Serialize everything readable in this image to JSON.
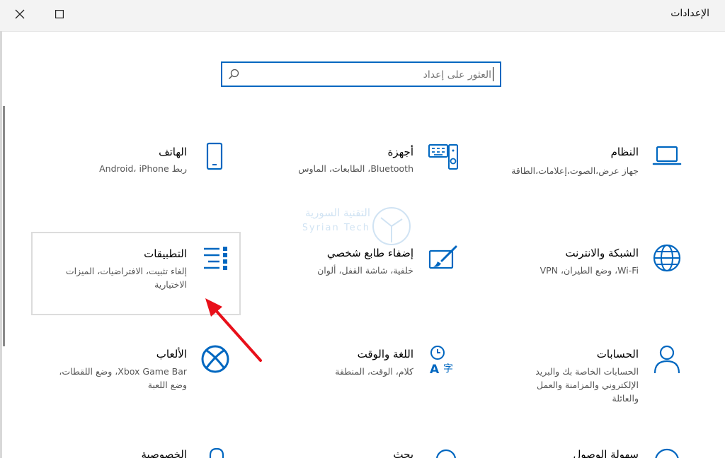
{
  "window": {
    "title": "الإعدادات",
    "close_icon": "close-icon",
    "maximize_icon": "maximize-icon"
  },
  "search": {
    "placeholder": "العثور على إعداد",
    "icon": "search-icon"
  },
  "tiles": {
    "system": {
      "title": "النظام",
      "desc": "جهاز عرض،الصوت،إعلامات،الطاقة",
      "icon": "laptop-icon"
    },
    "devices": {
      "title": "أجهزة",
      "desc": "Bluetooth، الطابعات، الماوس",
      "icon": "keyboard-speaker-icon"
    },
    "phone": {
      "title": "الهاتف",
      "desc": "ربط Android، iPhone",
      "icon": "phone-icon"
    },
    "network": {
      "title": "الشبكة والانترنت",
      "desc": "Wi-Fi، وضع الطيران، VPN",
      "icon": "globe-icon"
    },
    "personalization": {
      "title": "إضفاء طابع شخصي",
      "desc": "خلفية، شاشة القفل، ألوان",
      "icon": "paintbrush-icon"
    },
    "apps": {
      "title": "التطبيقات",
      "desc": "إلغاء تثبيت، الافتراضيات، الميزات الاختيارية",
      "icon": "apps-list-icon"
    },
    "accounts": {
      "title": "الحسابات",
      "desc": "الحسابات الخاصة بك والبريد الإلكتروني والمزامنة والعمل والعائلة",
      "icon": "person-icon"
    },
    "time_language": {
      "title": "اللغة والوقت",
      "desc": "كلام، الوقت، المنطقة",
      "icon": "time-language-icon"
    },
    "gaming": {
      "title": "الألعاب",
      "desc": "Xbox Game Bar، وضع اللقطات، وضع اللعبة",
      "icon": "xbox-icon"
    },
    "ease_of_access": {
      "title": "سهولة الوصول",
      "icon": "ease-of-access-icon"
    },
    "search_tile": {
      "title": "بحث",
      "icon": "search-icon"
    },
    "privacy": {
      "title": "الخصوصية",
      "icon": "lock-icon"
    }
  },
  "watermark": {
    "line1": "التقنية السورية",
    "line2": "Syrian Tech"
  },
  "colors": {
    "accent": "#0067c0",
    "arrow": "#e8101a"
  }
}
